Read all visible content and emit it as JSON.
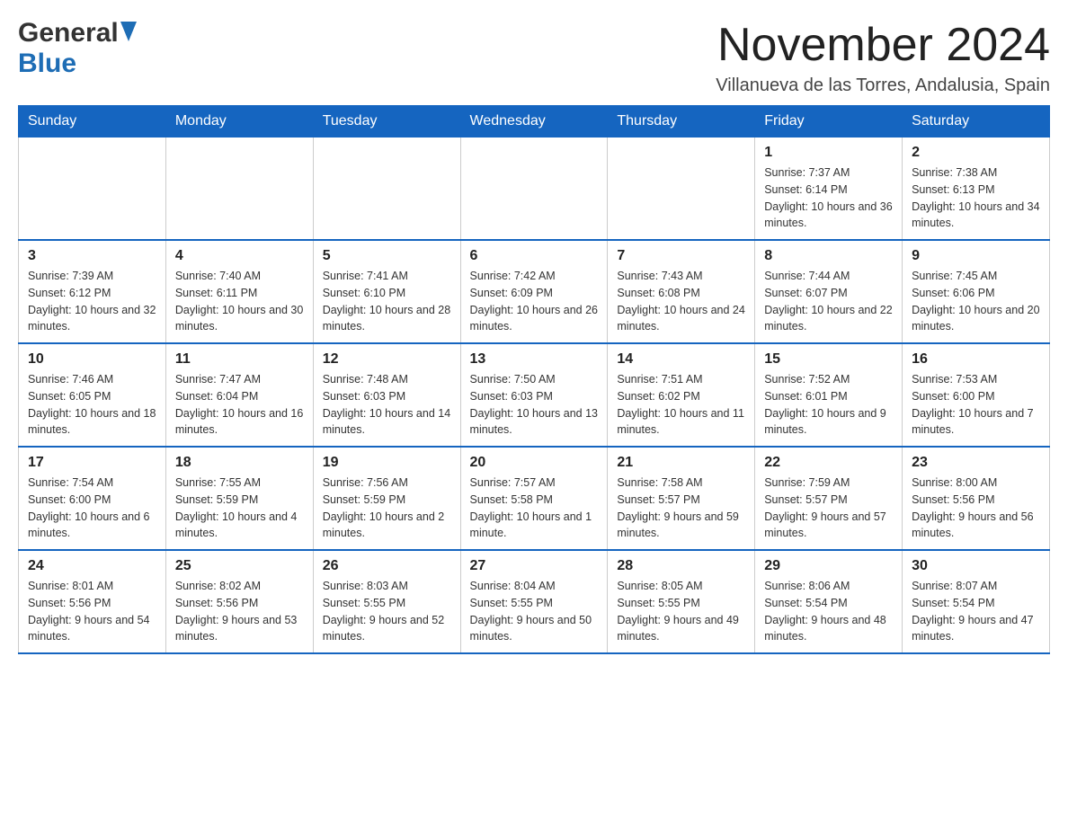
{
  "header": {
    "logo_general": "General",
    "logo_blue": "Blue",
    "month_title": "November 2024",
    "location": "Villanueva de las Torres, Andalusia, Spain"
  },
  "days_of_week": [
    "Sunday",
    "Monday",
    "Tuesday",
    "Wednesday",
    "Thursday",
    "Friday",
    "Saturday"
  ],
  "weeks": [
    [
      {
        "day": "",
        "info": ""
      },
      {
        "day": "",
        "info": ""
      },
      {
        "day": "",
        "info": ""
      },
      {
        "day": "",
        "info": ""
      },
      {
        "day": "",
        "info": ""
      },
      {
        "day": "1",
        "info": "Sunrise: 7:37 AM\nSunset: 6:14 PM\nDaylight: 10 hours and 36 minutes."
      },
      {
        "day": "2",
        "info": "Sunrise: 7:38 AM\nSunset: 6:13 PM\nDaylight: 10 hours and 34 minutes."
      }
    ],
    [
      {
        "day": "3",
        "info": "Sunrise: 7:39 AM\nSunset: 6:12 PM\nDaylight: 10 hours and 32 minutes."
      },
      {
        "day": "4",
        "info": "Sunrise: 7:40 AM\nSunset: 6:11 PM\nDaylight: 10 hours and 30 minutes."
      },
      {
        "day": "5",
        "info": "Sunrise: 7:41 AM\nSunset: 6:10 PM\nDaylight: 10 hours and 28 minutes."
      },
      {
        "day": "6",
        "info": "Sunrise: 7:42 AM\nSunset: 6:09 PM\nDaylight: 10 hours and 26 minutes."
      },
      {
        "day": "7",
        "info": "Sunrise: 7:43 AM\nSunset: 6:08 PM\nDaylight: 10 hours and 24 minutes."
      },
      {
        "day": "8",
        "info": "Sunrise: 7:44 AM\nSunset: 6:07 PM\nDaylight: 10 hours and 22 minutes."
      },
      {
        "day": "9",
        "info": "Sunrise: 7:45 AM\nSunset: 6:06 PM\nDaylight: 10 hours and 20 minutes."
      }
    ],
    [
      {
        "day": "10",
        "info": "Sunrise: 7:46 AM\nSunset: 6:05 PM\nDaylight: 10 hours and 18 minutes."
      },
      {
        "day": "11",
        "info": "Sunrise: 7:47 AM\nSunset: 6:04 PM\nDaylight: 10 hours and 16 minutes."
      },
      {
        "day": "12",
        "info": "Sunrise: 7:48 AM\nSunset: 6:03 PM\nDaylight: 10 hours and 14 minutes."
      },
      {
        "day": "13",
        "info": "Sunrise: 7:50 AM\nSunset: 6:03 PM\nDaylight: 10 hours and 13 minutes."
      },
      {
        "day": "14",
        "info": "Sunrise: 7:51 AM\nSunset: 6:02 PM\nDaylight: 10 hours and 11 minutes."
      },
      {
        "day": "15",
        "info": "Sunrise: 7:52 AM\nSunset: 6:01 PM\nDaylight: 10 hours and 9 minutes."
      },
      {
        "day": "16",
        "info": "Sunrise: 7:53 AM\nSunset: 6:00 PM\nDaylight: 10 hours and 7 minutes."
      }
    ],
    [
      {
        "day": "17",
        "info": "Sunrise: 7:54 AM\nSunset: 6:00 PM\nDaylight: 10 hours and 6 minutes."
      },
      {
        "day": "18",
        "info": "Sunrise: 7:55 AM\nSunset: 5:59 PM\nDaylight: 10 hours and 4 minutes."
      },
      {
        "day": "19",
        "info": "Sunrise: 7:56 AM\nSunset: 5:59 PM\nDaylight: 10 hours and 2 minutes."
      },
      {
        "day": "20",
        "info": "Sunrise: 7:57 AM\nSunset: 5:58 PM\nDaylight: 10 hours and 1 minute."
      },
      {
        "day": "21",
        "info": "Sunrise: 7:58 AM\nSunset: 5:57 PM\nDaylight: 9 hours and 59 minutes."
      },
      {
        "day": "22",
        "info": "Sunrise: 7:59 AM\nSunset: 5:57 PM\nDaylight: 9 hours and 57 minutes."
      },
      {
        "day": "23",
        "info": "Sunrise: 8:00 AM\nSunset: 5:56 PM\nDaylight: 9 hours and 56 minutes."
      }
    ],
    [
      {
        "day": "24",
        "info": "Sunrise: 8:01 AM\nSunset: 5:56 PM\nDaylight: 9 hours and 54 minutes."
      },
      {
        "day": "25",
        "info": "Sunrise: 8:02 AM\nSunset: 5:56 PM\nDaylight: 9 hours and 53 minutes."
      },
      {
        "day": "26",
        "info": "Sunrise: 8:03 AM\nSunset: 5:55 PM\nDaylight: 9 hours and 52 minutes."
      },
      {
        "day": "27",
        "info": "Sunrise: 8:04 AM\nSunset: 5:55 PM\nDaylight: 9 hours and 50 minutes."
      },
      {
        "day": "28",
        "info": "Sunrise: 8:05 AM\nSunset: 5:55 PM\nDaylight: 9 hours and 49 minutes."
      },
      {
        "day": "29",
        "info": "Sunrise: 8:06 AM\nSunset: 5:54 PM\nDaylight: 9 hours and 48 minutes."
      },
      {
        "day": "30",
        "info": "Sunrise: 8:07 AM\nSunset: 5:54 PM\nDaylight: 9 hours and 47 minutes."
      }
    ]
  ]
}
